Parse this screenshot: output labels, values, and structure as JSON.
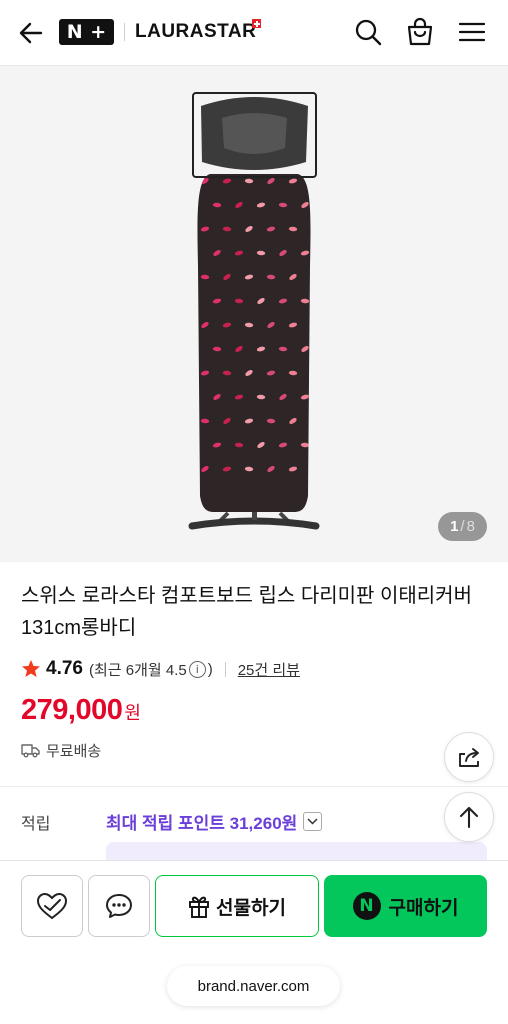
{
  "header": {
    "back_icon": "arrow-left-icon",
    "nplus_letters": [
      "N",
      "+"
    ],
    "brand_logo": "LAURASTAR",
    "search_icon": "search-icon",
    "cart_icon": "shopping-bag-icon",
    "menu_icon": "hamburger-menu-icon"
  },
  "gallery": {
    "current": "1",
    "separator": "/",
    "total": "8"
  },
  "product": {
    "title": "스위스 로라스타 컴포트보드 립스 다리미판 이태리커버 131cm롱바디",
    "rating": "4.76",
    "recent_rating": "(최근 6개월 4.5",
    "recent_info_glyph": "i",
    "recent_close": ")",
    "review_count": "25건 리뷰",
    "price": "279,000",
    "currency": "원",
    "shipping": "무료배송",
    "points_label": "적립",
    "points_value": "최대 적립 포인트 31,260원"
  },
  "floating": {
    "share_icon": "share-icon",
    "scroll_top_icon": "arrow-up-icon"
  },
  "bottom_bar": {
    "like_icon": "heart-check-icon",
    "talk_icon": "chat-bubble-icon",
    "gift_label": "선물하기",
    "buy_badge": "N",
    "buy_label": "구매하기",
    "url": "brand.naver.com"
  },
  "colors": {
    "price_red": "#e3072a",
    "points_purple": "#6b3fd9",
    "naver_green": "#03c75a"
  }
}
